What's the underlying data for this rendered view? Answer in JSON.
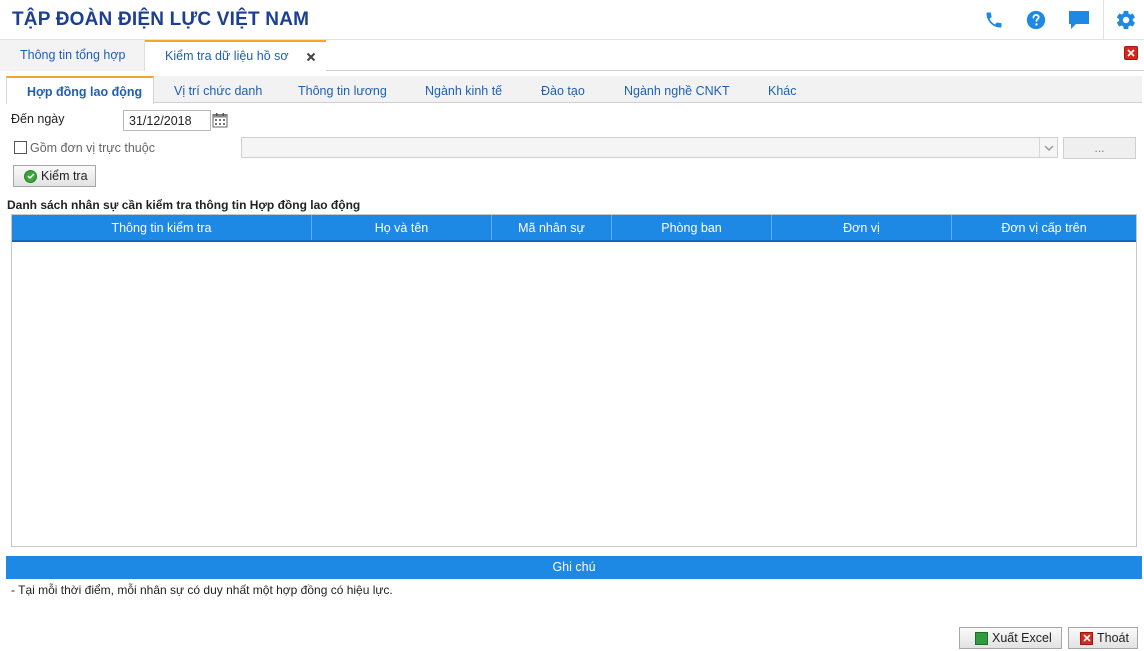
{
  "header": {
    "title": "TẬP ĐOÀN ĐIỆN LỰC VIỆT NAM",
    "icons": [
      "phone-icon",
      "help-icon",
      "chat-icon",
      "gear-icon"
    ],
    "brand_color": "#1c3f94"
  },
  "top_tabs": [
    {
      "label": "Thông tin tổng hợp",
      "active": false
    },
    {
      "label": "Kiểm tra dữ liệu hồ sơ",
      "active": true
    }
  ],
  "sub_tabs": [
    {
      "label": "Hợp đồng lao động",
      "active": true
    },
    {
      "label": "Vị trí chức danh",
      "active": false
    },
    {
      "label": "Thông tin lương",
      "active": false
    },
    {
      "label": "Ngành kinh tế",
      "active": false
    },
    {
      "label": "Đào tạo",
      "active": false
    },
    {
      "label": "Ngành nghề CNKT",
      "active": false
    },
    {
      "label": "Khác",
      "active": false
    }
  ],
  "filters": {
    "date_label": "Đến ngày",
    "date_value": "31/12/2018",
    "include_units_label": "Gồm đơn vị trực thuộc",
    "include_units_checked": false,
    "unit_select_value": "",
    "browse_label": "...",
    "check_button": "Kiểm tra"
  },
  "list_title": "Danh sách nhân sự cần kiểm tra thông tin Hợp đồng lao động",
  "table": {
    "columns": [
      "Thông tin kiểm tra",
      "Họ và tên",
      "Mã nhân sự",
      "Phòng ban",
      "Đơn vị",
      "Đơn vị cấp trên"
    ],
    "rows": []
  },
  "notes": {
    "title": "Ghi chú",
    "lines": [
      "- Tại mỗi thời điểm, mỗi nhân sự có duy nhất một hợp đồng có hiệu lực."
    ]
  },
  "footer": {
    "export_label": "Xuất Excel",
    "exit_label": "Thoát"
  },
  "colors": {
    "accent": "#1e88e5",
    "tab_highlight": "#f5a623",
    "link": "#1f5fb3"
  }
}
